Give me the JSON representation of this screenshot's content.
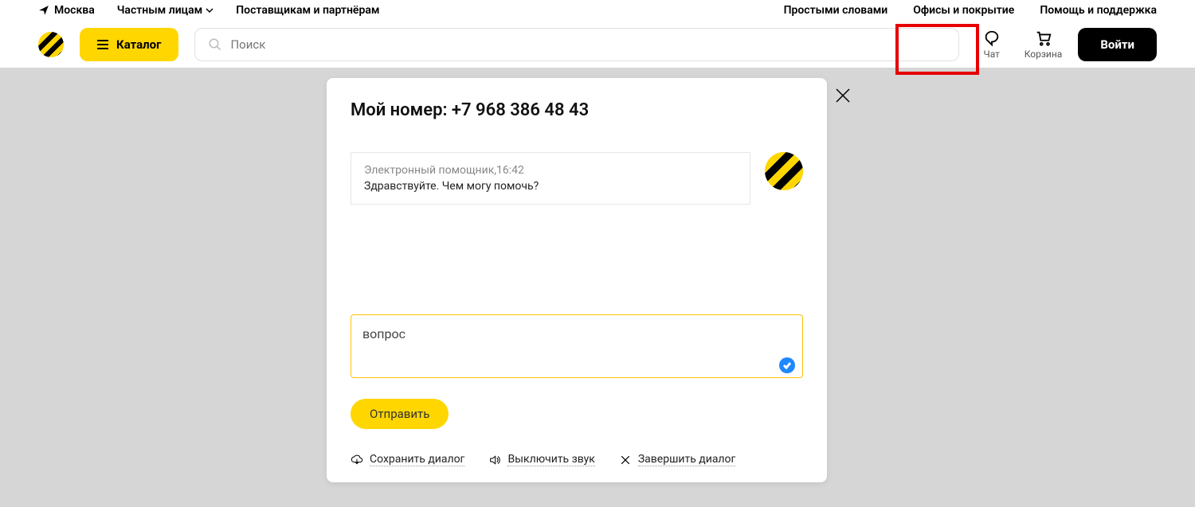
{
  "topbar": {
    "city": "Москва",
    "audience_link": "Частным лицам",
    "partners_link": "Поставщикам и партнёрам",
    "plain_words": "Простыми словами",
    "offices": "Офисы и покрытие",
    "help": "Помощь и поддержка"
  },
  "mainbar": {
    "catalog_label": "Каталог",
    "search_placeholder": "Поиск",
    "chat_label": "Чат",
    "cart_label": "Корзина",
    "login_label": "Войти"
  },
  "chat": {
    "title": "Мой номер: +7 968 386 48 43",
    "bot": {
      "sender_line": "Электронный помощник,16:42",
      "text": "Здравствуйте. Чем могу помочь?"
    },
    "input_value": "вопрос",
    "send_label": "Отправить",
    "actions": {
      "save": "Сохранить диалог",
      "mute": "Выключить звук",
      "end": "Завершить диалог"
    }
  }
}
